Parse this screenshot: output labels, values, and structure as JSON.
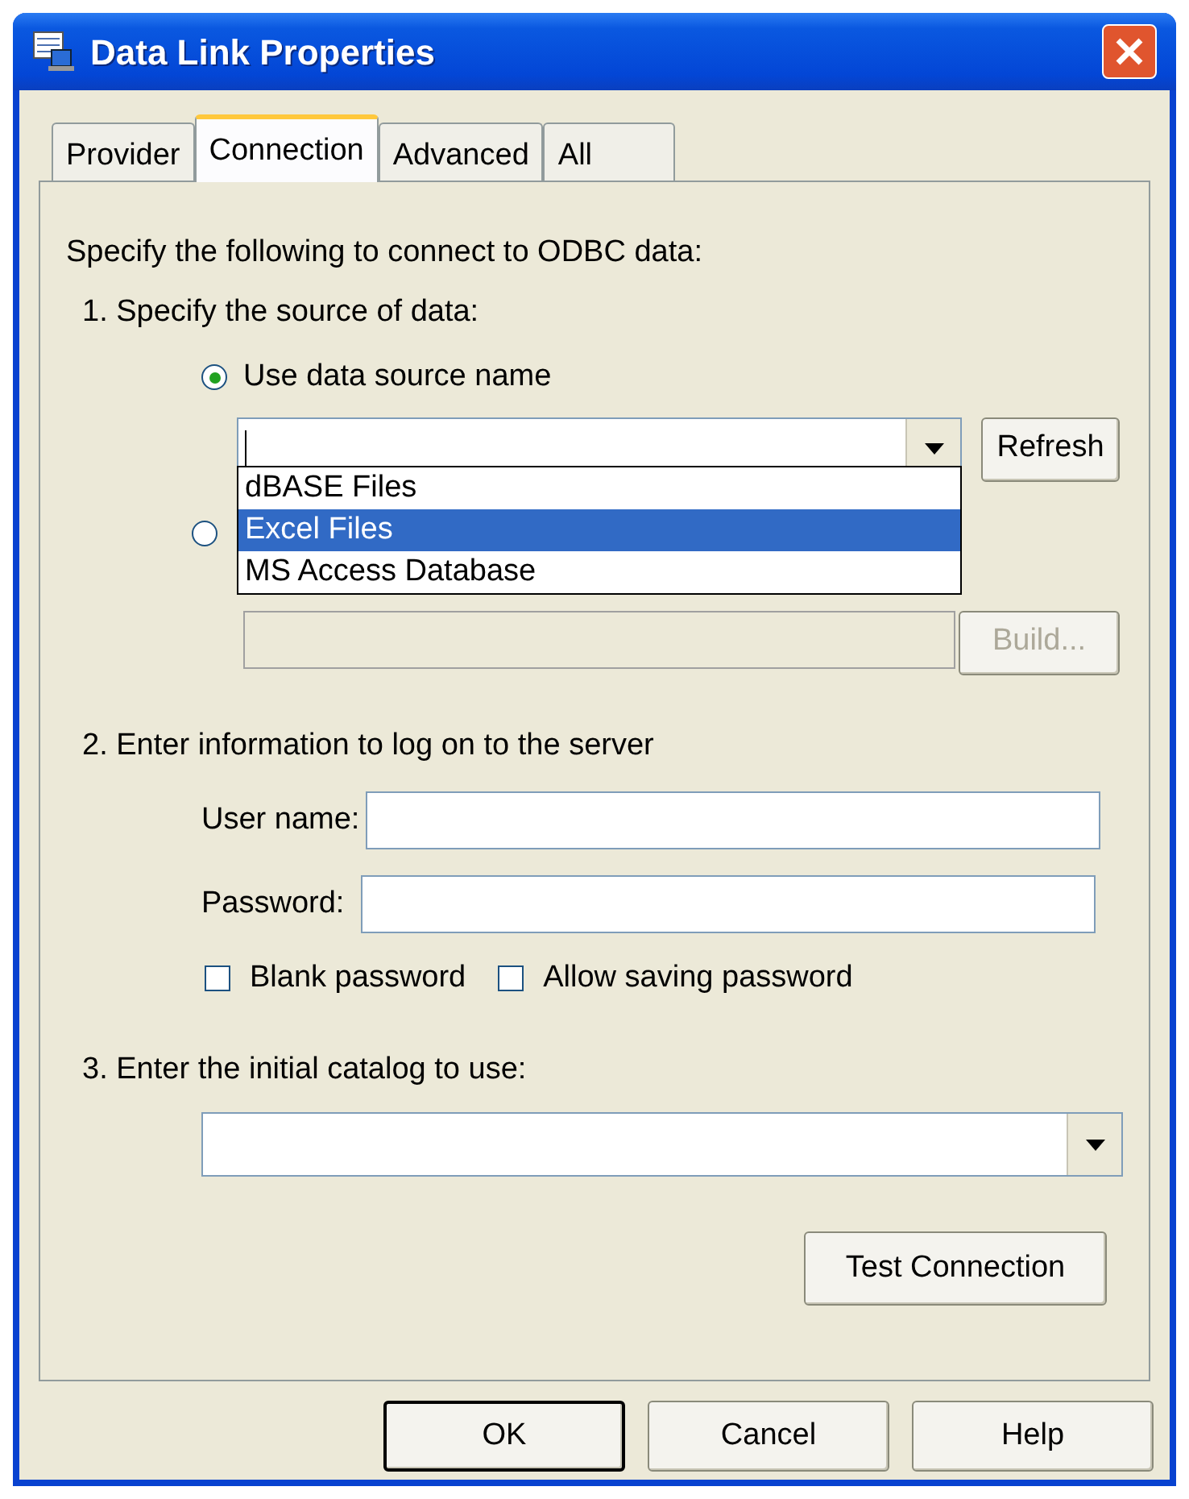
{
  "window": {
    "title": "Data Link Properties"
  },
  "tabs": [
    {
      "label": "Provider",
      "selected": false
    },
    {
      "label": "Connection",
      "selected": true
    },
    {
      "label": "Advanced",
      "selected": false
    },
    {
      "label": "All",
      "selected": false
    }
  ],
  "intro": "Specify the following to connect to ODBC data:",
  "step1": {
    "heading": "1. Specify the source of data:",
    "radios": [
      {
        "label": "Use data source name",
        "selected": true
      },
      {
        "selected": false
      }
    ],
    "dropdown": [
      {
        "label": "dBASE Files",
        "selected": false
      },
      {
        "label": "Excel Files",
        "selected": true
      },
      {
        "label": "MS Access Database",
        "selected": false
      }
    ],
    "refresh": "Refresh",
    "connection_string": {
      "disabled": true
    },
    "build": {
      "label": "Build...",
      "disabled": true
    }
  },
  "step2": {
    "heading": "2. Enter information to log on to the server",
    "user_label": "User name:",
    "password_label": "Password:",
    "checkboxes": [
      {
        "label": "Blank password",
        "checked": false
      },
      {
        "label": "Allow saving password",
        "checked": false
      }
    ]
  },
  "step3": {
    "heading": "3. Enter the initial catalog to use:"
  },
  "test_button": "Test Connection",
  "buttons": [
    {
      "label": "OK",
      "default": true
    },
    {
      "label": "Cancel",
      "default": false
    },
    {
      "label": "Help",
      "default": false
    }
  ]
}
